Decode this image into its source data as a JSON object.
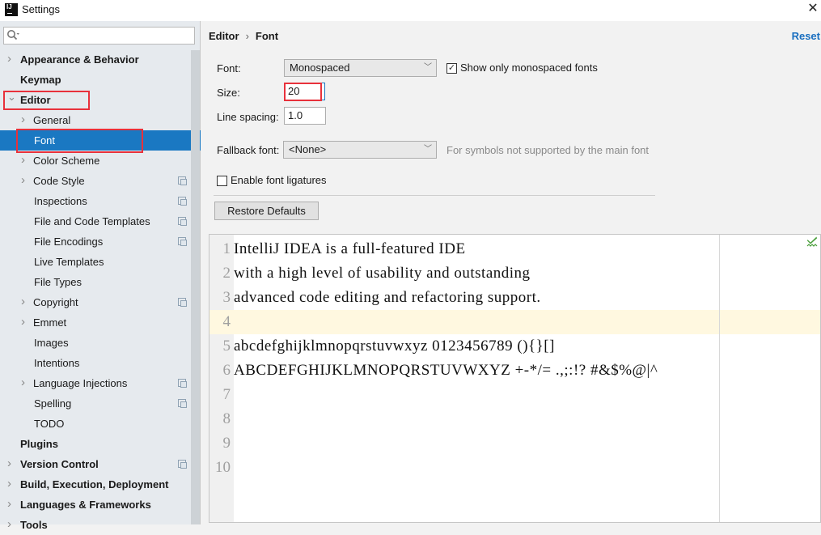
{
  "window": {
    "title": "Settings",
    "app_icon": "IJ",
    "close_glyph": "✕"
  },
  "sidebar": {
    "search": {
      "placeholder": "",
      "value": ""
    },
    "items": [
      {
        "label": "Appearance & Behavior",
        "level": 0,
        "bold": true,
        "expandable": true,
        "expanded": false,
        "project_icon": false
      },
      {
        "label": "Keymap",
        "level": 0,
        "bold": true,
        "expandable": false,
        "project_icon": false
      },
      {
        "label": "Editor",
        "level": 0,
        "bold": true,
        "expandable": true,
        "expanded": true,
        "project_icon": false,
        "highlighted": true
      },
      {
        "label": "General",
        "level": 1,
        "bold": false,
        "expandable": true,
        "expanded": false,
        "project_icon": false
      },
      {
        "label": "Font",
        "level": 1,
        "bold": false,
        "expandable": false,
        "project_icon": false,
        "selected": true,
        "highlighted": true
      },
      {
        "label": "Color Scheme",
        "level": 1,
        "bold": false,
        "expandable": true,
        "expanded": false,
        "project_icon": false
      },
      {
        "label": "Code Style",
        "level": 1,
        "bold": false,
        "expandable": true,
        "expanded": false,
        "project_icon": true
      },
      {
        "label": "Inspections",
        "level": 1,
        "bold": false,
        "expandable": false,
        "project_icon": true
      },
      {
        "label": "File and Code Templates",
        "level": 1,
        "bold": false,
        "expandable": false,
        "project_icon": true
      },
      {
        "label": "File Encodings",
        "level": 1,
        "bold": false,
        "expandable": false,
        "project_icon": true
      },
      {
        "label": "Live Templates",
        "level": 1,
        "bold": false,
        "expandable": false,
        "project_icon": false
      },
      {
        "label": "File Types",
        "level": 1,
        "bold": false,
        "expandable": false,
        "project_icon": false
      },
      {
        "label": "Copyright",
        "level": 1,
        "bold": false,
        "expandable": true,
        "expanded": false,
        "project_icon": true
      },
      {
        "label": "Emmet",
        "level": 1,
        "bold": false,
        "expandable": true,
        "expanded": false,
        "project_icon": false
      },
      {
        "label": "Images",
        "level": 1,
        "bold": false,
        "expandable": false,
        "project_icon": false
      },
      {
        "label": "Intentions",
        "level": 1,
        "bold": false,
        "expandable": false,
        "project_icon": false
      },
      {
        "label": "Language Injections",
        "level": 1,
        "bold": false,
        "expandable": true,
        "expanded": false,
        "project_icon": true
      },
      {
        "label": "Spelling",
        "level": 1,
        "bold": false,
        "expandable": false,
        "project_icon": true
      },
      {
        "label": "TODO",
        "level": 1,
        "bold": false,
        "expandable": false,
        "project_icon": false
      },
      {
        "label": "Plugins",
        "level": 0,
        "bold": true,
        "expandable": false,
        "project_icon": false
      },
      {
        "label": "Version Control",
        "level": 0,
        "bold": true,
        "expandable": true,
        "expanded": false,
        "project_icon": true
      },
      {
        "label": "Build, Execution, Deployment",
        "level": 0,
        "bold": true,
        "expandable": true,
        "expanded": false,
        "project_icon": false
      },
      {
        "label": "Languages & Frameworks",
        "level": 0,
        "bold": true,
        "expandable": true,
        "expanded": false,
        "project_icon": false
      },
      {
        "label": "Tools",
        "level": 0,
        "bold": true,
        "expandable": true,
        "expanded": false,
        "project_icon": false
      }
    ]
  },
  "header": {
    "breadcrumb": [
      "Editor",
      "Font"
    ],
    "breadcrumb_separator": "›",
    "reset_label": "Reset"
  },
  "form": {
    "font_label": "Font:",
    "font_value": "Monospaced",
    "show_mono_label": "Show only monospaced fonts",
    "show_mono_checked": true,
    "size_label": "Size:",
    "size_value": "20",
    "line_spacing_label": "Line spacing:",
    "line_spacing_value": "1.0",
    "fallback_label": "Fallback font:",
    "fallback_value": "<None>",
    "fallback_hint": "For symbols not supported by the main font",
    "ligatures_label": "Enable font ligatures",
    "ligatures_checked": false,
    "restore_label": "Restore Defaults"
  },
  "preview": {
    "current_line": 4,
    "lines": [
      {
        "no": "1",
        "text": "IntelliJ IDEA is a full-featured IDE"
      },
      {
        "no": "2",
        "text": "with a high level of usability and outstanding"
      },
      {
        "no": "3",
        "text": "advanced code editing and refactoring support."
      },
      {
        "no": "4",
        "text": ""
      },
      {
        "no": "5",
        "text": "abcdefghijklmnopqrstuvwxyz 0123456789 (){}[]"
      },
      {
        "no": "6",
        "text": "ABCDEFGHIJKLMNOPQRSTUVWXYZ +-*/= .,;:!? #&$%@|^"
      },
      {
        "no": "7",
        "text": ""
      },
      {
        "no": "8",
        "text": ""
      },
      {
        "no": "9",
        "text": ""
      },
      {
        "no": "10",
        "text": ""
      }
    ],
    "status_icon": "inspection-ok-icon"
  },
  "colors": {
    "selection": "#1a78c2",
    "highlight_box": "#e8313b",
    "link": "#1a6fc0",
    "current_line_bg": "#fff8e0"
  }
}
